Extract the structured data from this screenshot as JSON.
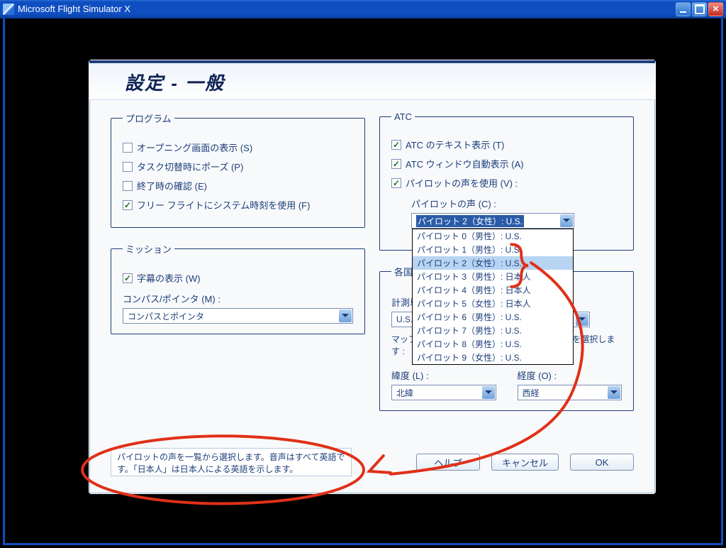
{
  "window": {
    "title": "Microsoft Flight Simulator X"
  },
  "dialog": {
    "title": "設定 - 一般"
  },
  "program": {
    "legend": "プログラム",
    "opening": {
      "label": "オープニング画面の表示 (S)",
      "checked": false
    },
    "pause_on_task_switch": {
      "label": "タスク切替時にポーズ (P)",
      "checked": false
    },
    "confirm_exit": {
      "label": "終了時の確認 (E)",
      "checked": false
    },
    "system_time": {
      "label": "フリー フライトにシステム時刻を使用 (F)",
      "checked": true
    }
  },
  "mission": {
    "legend": "ミッション",
    "subtitles": {
      "label": "字幕の表示 (W)",
      "checked": true
    },
    "compass_label": "コンパス/ポインタ (M) :",
    "compass_value": "コンパスとポインタ"
  },
  "atc": {
    "legend": "ATC",
    "text_display": {
      "label": "ATC のテキスト表示 (T)",
      "checked": true
    },
    "window_auto": {
      "label": "ATC ウィンドウ自動表示 (A)",
      "checked": true
    },
    "use_pilot_voice": {
      "label": "パイロットの声を使用 (V) :",
      "checked": true
    },
    "pilot_voice_label": "パイロットの声 (C) :",
    "pilot_voice_selected": "パイロット 2（女性）: U.S.",
    "pilot_voice_options": [
      "パイロット 0（男性）: U.S.",
      "パイロット 1（男性）: U.S.",
      "パイロット 2（女性）: U.S.",
      "パイロット 3（男性）: 日本人",
      "パイロット 4（男性）: 日本人",
      "パイロット 5（女性）: 日本人",
      "パイロット 6（男性）: U.S.",
      "パイロット 7（男性）: U.S.",
      "パイロット 8（男性）: U.S.",
      "パイロット 9（女性）: U.S."
    ],
    "highlight_index": 2
  },
  "intl": {
    "legend": "各国対応",
    "units_label": "計測単位 (U)",
    "units_value": "U.S.",
    "map_desc": "マップ ダイアログの緯度と経度の標準の座標系を選択します :",
    "lat_label": "緯度 (L) :",
    "lat_value": "北緯",
    "lon_label": "経度 (O) :",
    "lon_value": "西経"
  },
  "footer": {
    "help_text": "パイロットの声を一覧から選択します。音声はすべて英語です。「日本人」は日本人による英語を示します。",
    "help_btn": "ヘルプ",
    "cancel_btn": "キャンセル",
    "ok_btn": "OK"
  },
  "annotation": {
    "color": "#e03018"
  }
}
